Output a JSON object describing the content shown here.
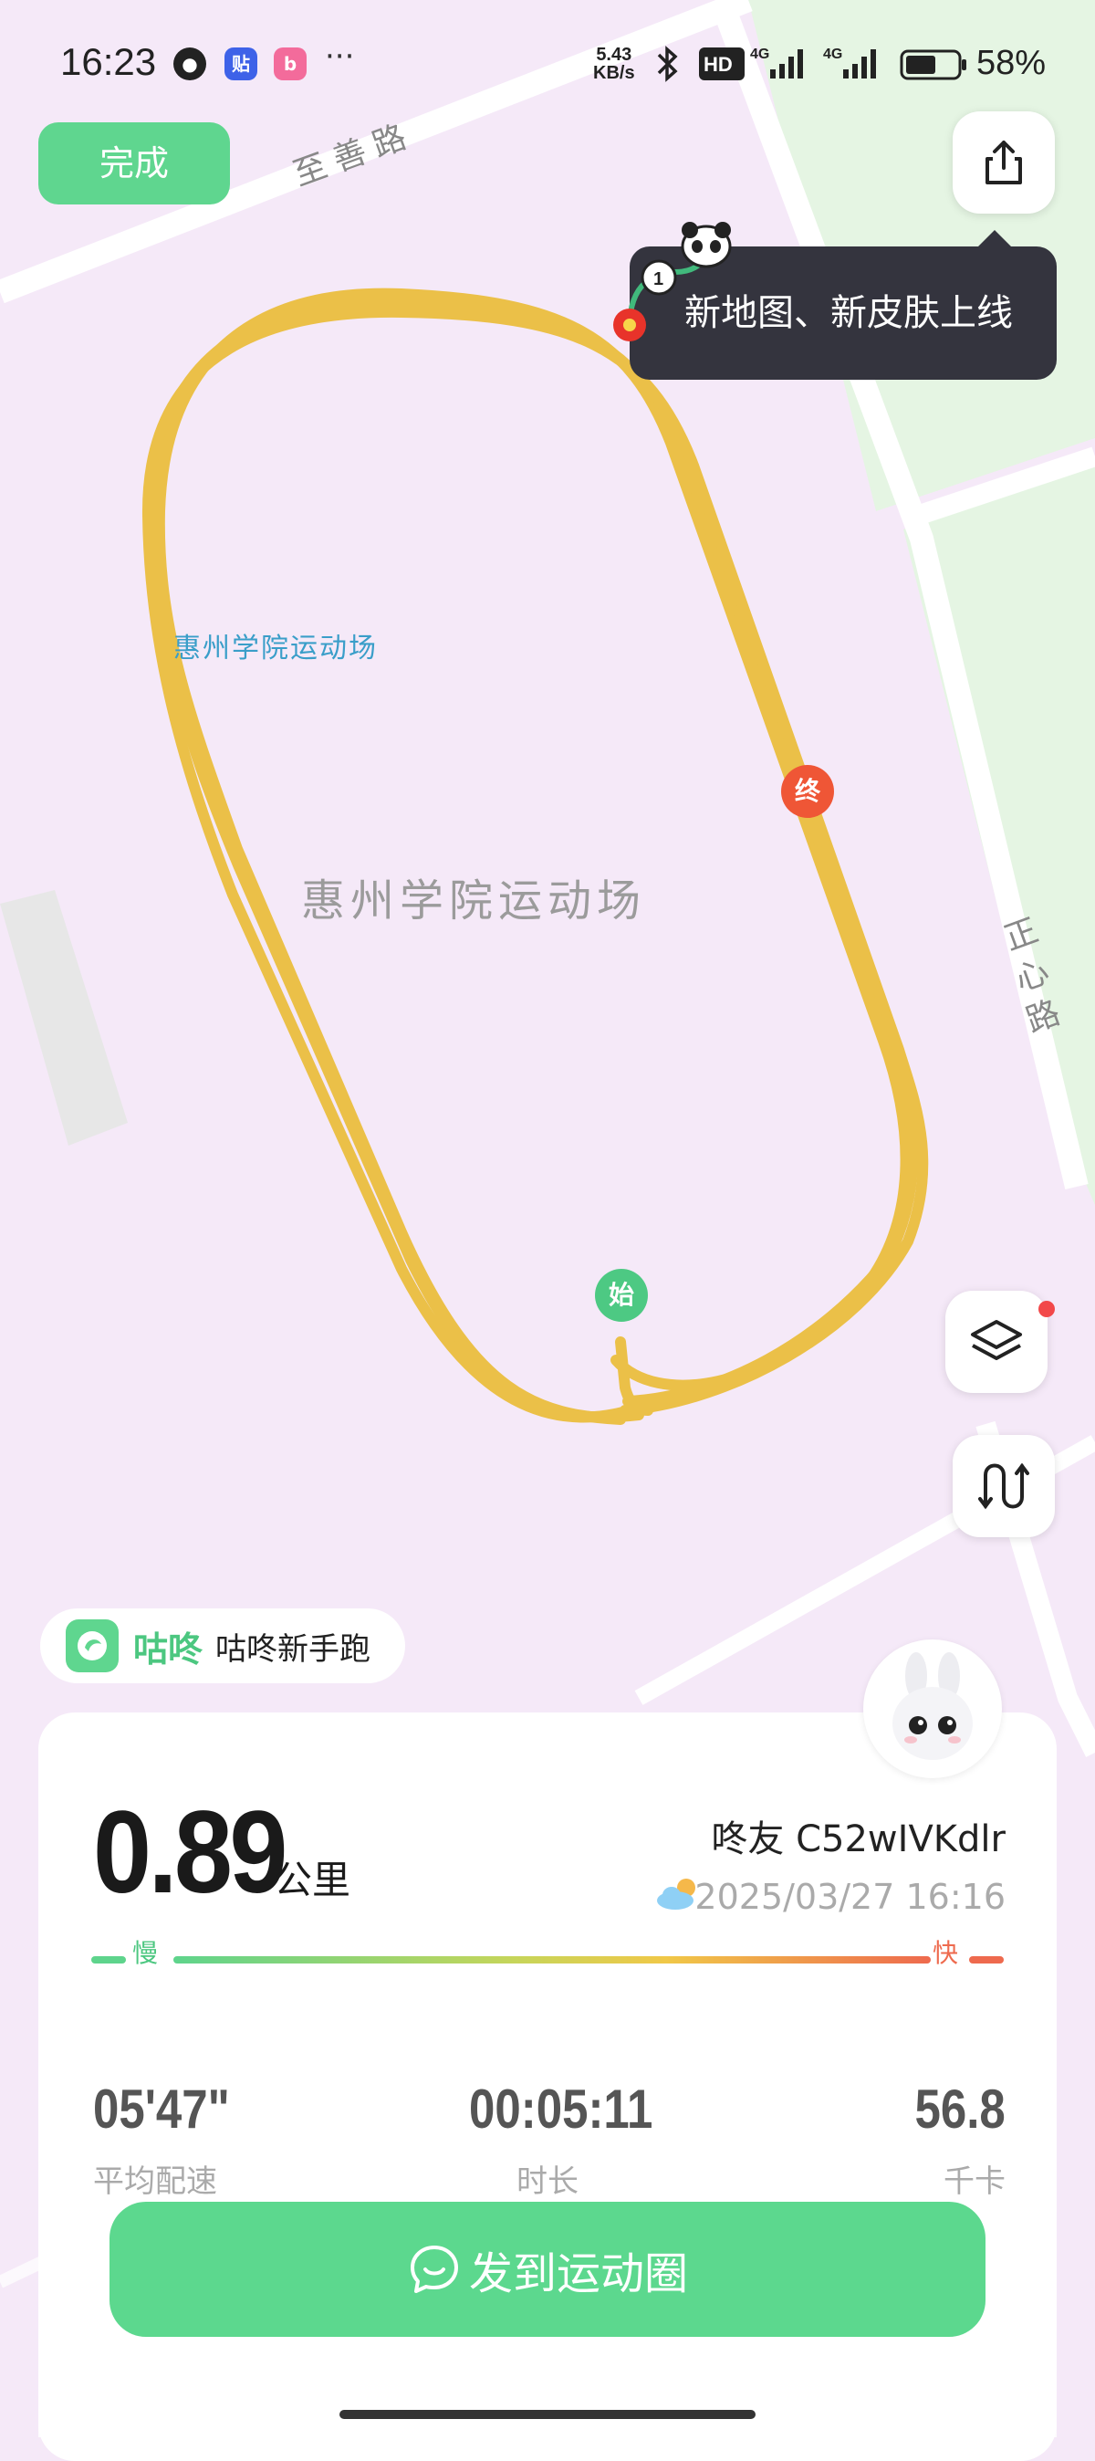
{
  "status_bar": {
    "time": "16:23",
    "app_icons": [
      "qq-icon",
      "tieba-icon",
      "bilibili-icon"
    ],
    "more": "···",
    "net_speed_value": "5.43",
    "net_speed_unit": "KB/s",
    "battery_percent": "58%"
  },
  "toolbar": {
    "done_label": "完成",
    "share_icon": "share-icon",
    "layers_icon": "layers-icon",
    "route_icon": "route-icon"
  },
  "tooltip": {
    "text": "新地图、新皮肤上线"
  },
  "map": {
    "venue_small": "惠州学院运动场",
    "venue_big": "惠州学院运动场",
    "road_north": "至善路",
    "road_east": [
      "正",
      "心",
      "路"
    ],
    "start_marker": "始",
    "end_marker": "终",
    "route_color": "#ebc048"
  },
  "badge": {
    "brand": "咕咚",
    "title": "咕咚新手跑"
  },
  "summary": {
    "distance": "0.89",
    "distance_unit": "公里",
    "username": "咚友 C52wIVKdlr",
    "datetime": "2025/03/27 16:16",
    "pace_slow": "慢",
    "pace_fast": "快",
    "stats": [
      {
        "value": "05'47\"",
        "label": "平均配速"
      },
      {
        "value": "00:05:11",
        "label": "时长"
      },
      {
        "value": "56.8",
        "label": "千卡"
      }
    ]
  },
  "share_button": {
    "label": "发到运动圈"
  }
}
